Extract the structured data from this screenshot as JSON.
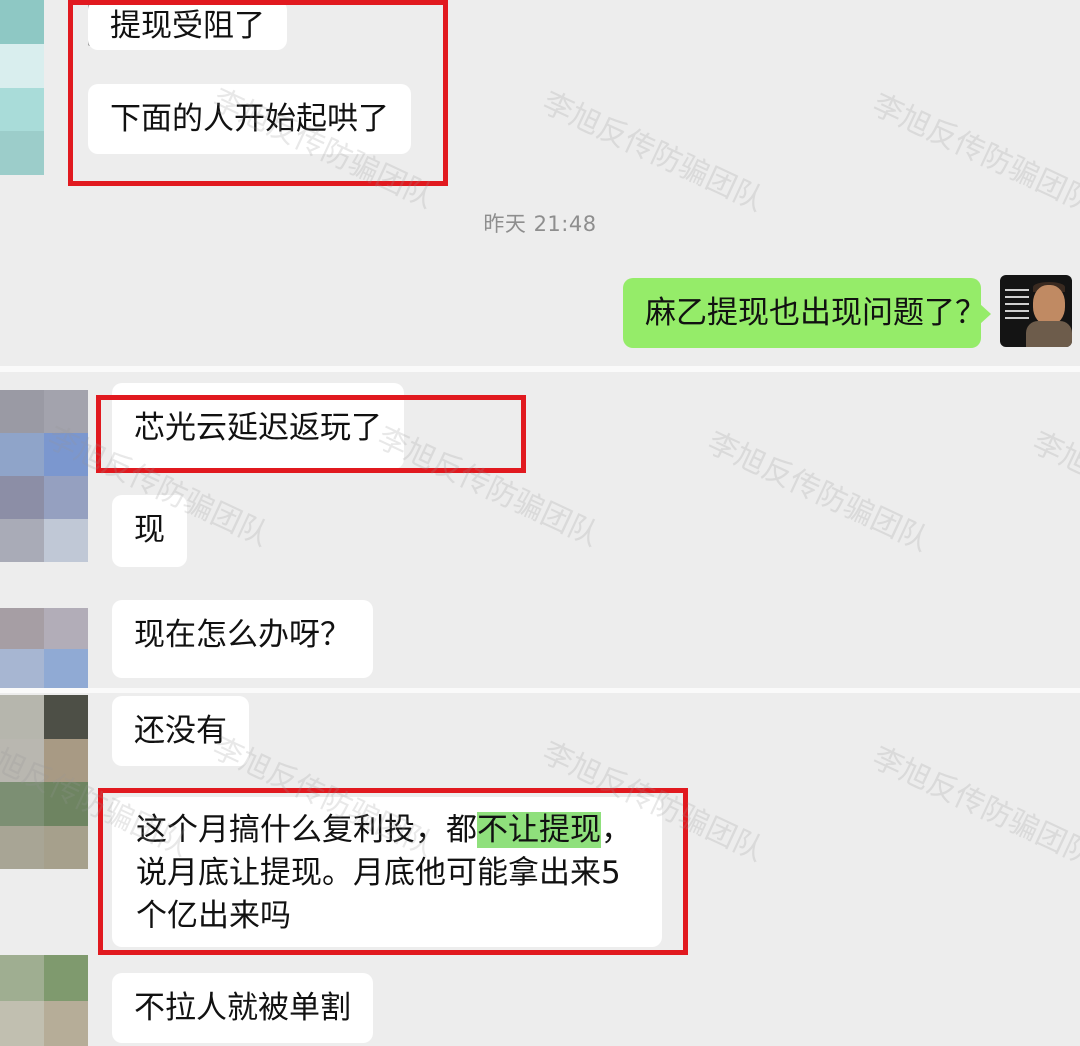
{
  "panel1": {
    "messages": [
      {
        "text": "提现受阻了"
      },
      {
        "text": "下面的人开始起哄了"
      }
    ],
    "timestamp": "昨天 21:48",
    "self_message": "麻乙提现也出现问题了？"
  },
  "panel2": {
    "messages": [
      {
        "text": "芯光云延迟返玩了"
      },
      {
        "text": "现"
      },
      {
        "text": "现在怎么办呀？"
      }
    ]
  },
  "panel3": {
    "messages": [
      {
        "text": "还没有"
      },
      {
        "text_before": "这个月搞什么复利投，都",
        "highlight": "不让提现",
        "text_after": "，说月底让提现。月底他可能拿出来5个亿出来吗"
      },
      {
        "text": "不拉人就被单割"
      }
    ]
  },
  "watermark": "李旭反传防骗团队",
  "colors": {
    "chat_bg": "#ededed",
    "self_bubble": "#95ec69",
    "annotation_red": "#e1191f",
    "highlight": "#8fe07c"
  }
}
